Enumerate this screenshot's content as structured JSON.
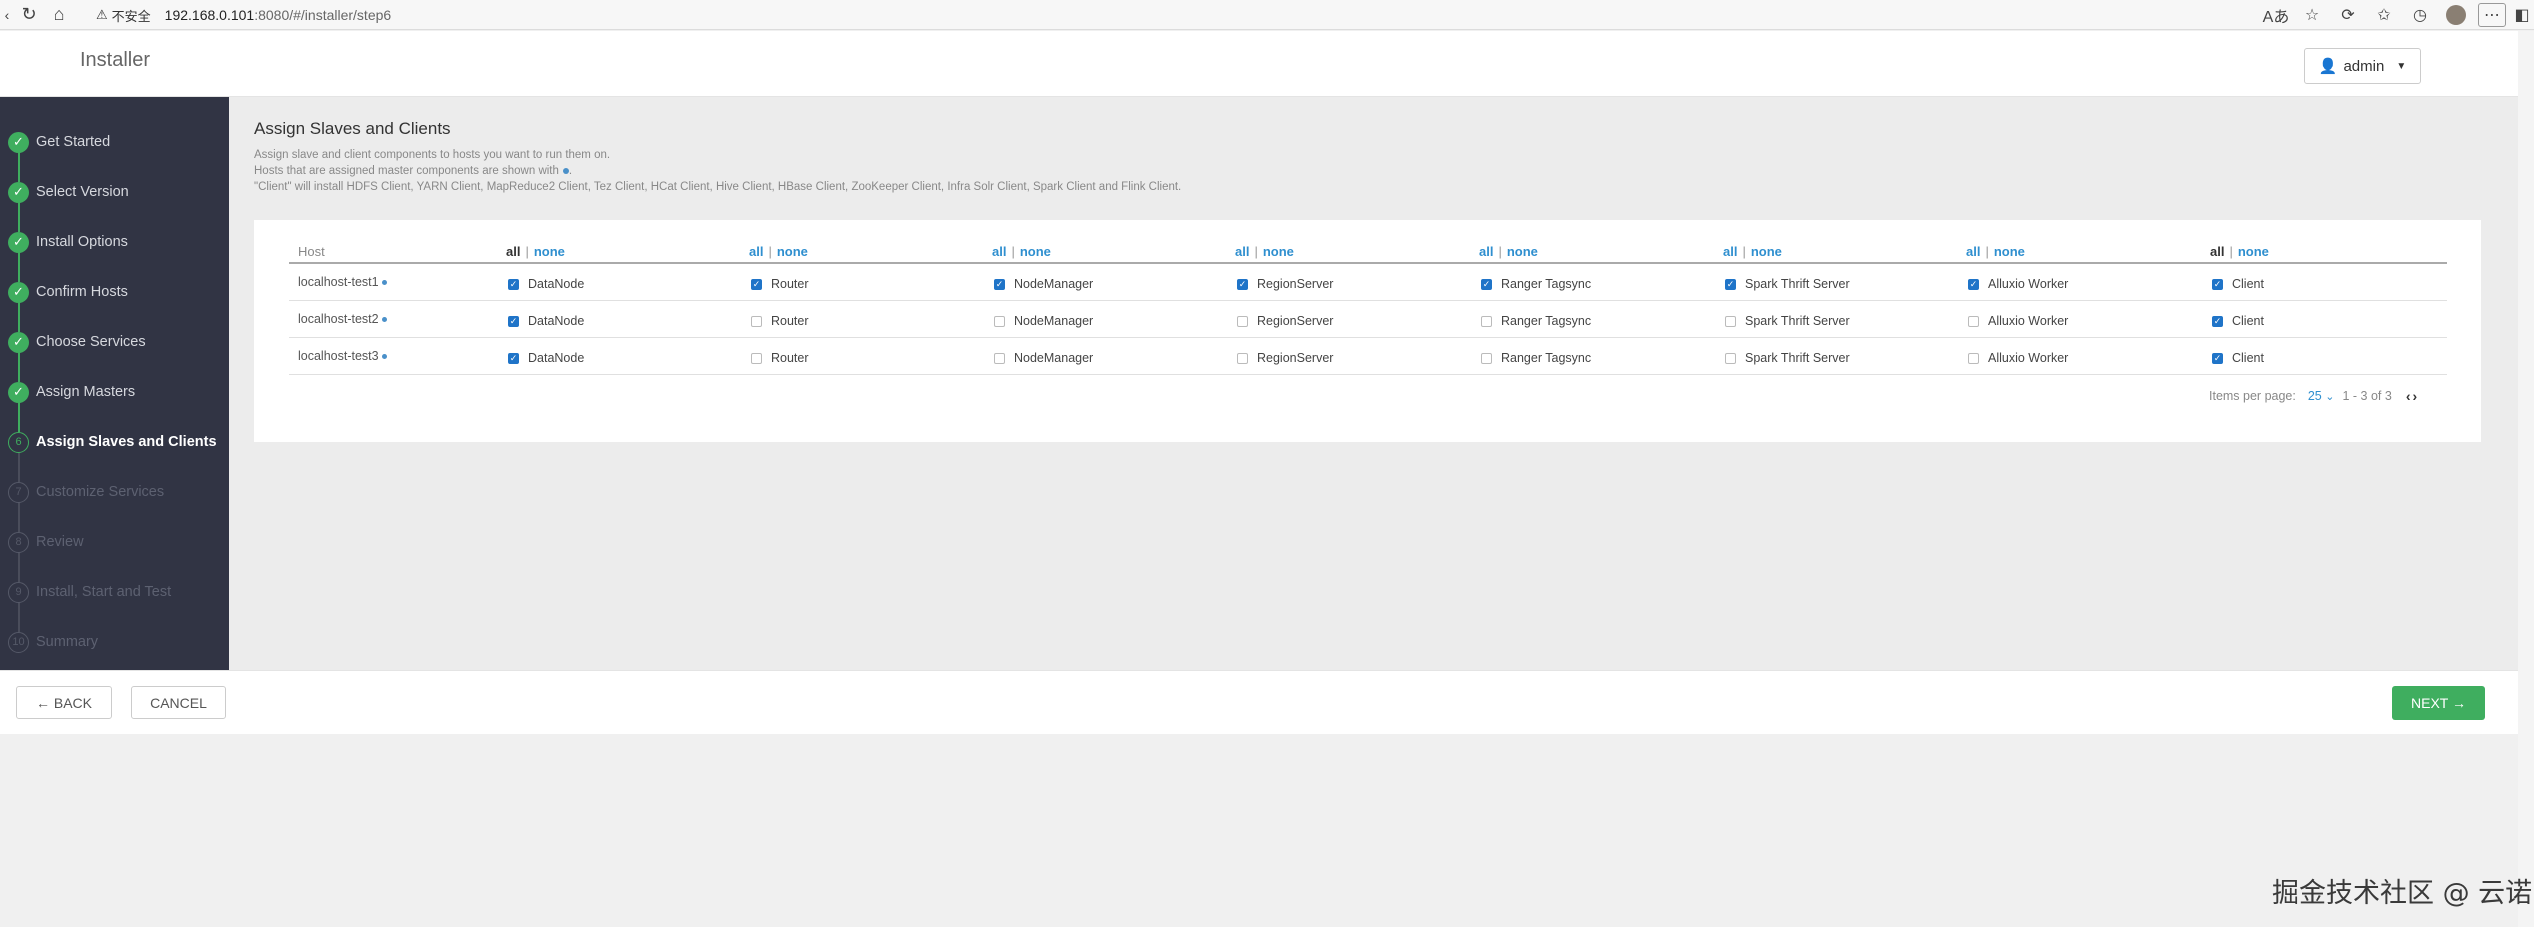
{
  "browser": {
    "insecure_label": "不安全",
    "url_host": "192.168.0.101",
    "url_rest": ":8080/#/installer/step6"
  },
  "header": {
    "brand": "Installer",
    "user": "admin"
  },
  "steps": [
    {
      "num": "1",
      "label": "Get Started",
      "state": "done"
    },
    {
      "num": "2",
      "label": "Select Version",
      "state": "done"
    },
    {
      "num": "3",
      "label": "Install Options",
      "state": "done"
    },
    {
      "num": "4",
      "label": "Confirm Hosts",
      "state": "done"
    },
    {
      "num": "5",
      "label": "Choose Services",
      "state": "done"
    },
    {
      "num": "6",
      "label": "Assign Masters",
      "state": "done"
    },
    {
      "num": "6",
      "label": "Assign Slaves and Clients",
      "state": "current"
    },
    {
      "num": "7",
      "label": "Customize Services",
      "state": "todo"
    },
    {
      "num": "8",
      "label": "Review",
      "state": "todo"
    },
    {
      "num": "9",
      "label": "Install, Start and Test",
      "state": "todo"
    },
    {
      "num": "10",
      "label": "Summary",
      "state": "todo"
    }
  ],
  "main": {
    "title": "Assign Slaves and Clients",
    "desc1": "Assign slave and client components to hosts you want to run them on.",
    "desc2": "Hosts that are assigned master components are shown with",
    "desc3": "\"Client\" will install HDFS Client, YARN Client, MapReduce2 Client, Tez Client, HCat Client, Hive Client, HBase Client, ZooKeeper Client, Infra Solr Client, Spark Client and Flink Client."
  },
  "table": {
    "host_header": "Host",
    "all_label": "all",
    "sep": "|",
    "none_label": "none",
    "columns": [
      "DataNode",
      "Router",
      "NodeManager",
      "RegionServer",
      "Ranger Tagsync",
      "Spark Thrift Server",
      "Alluxio Worker",
      "Client"
    ],
    "rows": [
      {
        "host": "localhost-test1",
        "checked": [
          true,
          true,
          true,
          true,
          true,
          true,
          true,
          true
        ]
      },
      {
        "host": "localhost-test2",
        "checked": [
          true,
          false,
          false,
          false,
          false,
          false,
          false,
          true
        ]
      },
      {
        "host": "localhost-test3",
        "checked": [
          true,
          false,
          false,
          false,
          false,
          false,
          false,
          true
        ]
      }
    ]
  },
  "pager": {
    "label": "Items per page:",
    "size": "25",
    "range": "1 - 3 of 3"
  },
  "footer": {
    "back": "← BACK",
    "cancel": "CANCEL",
    "next": "NEXT →"
  },
  "watermark": "掘金技术社区 @ 云诺",
  "colors": {
    "accent_green": "#3fae5f",
    "link_blue": "#2f8fcf",
    "sidebar_bg": "#313444"
  }
}
